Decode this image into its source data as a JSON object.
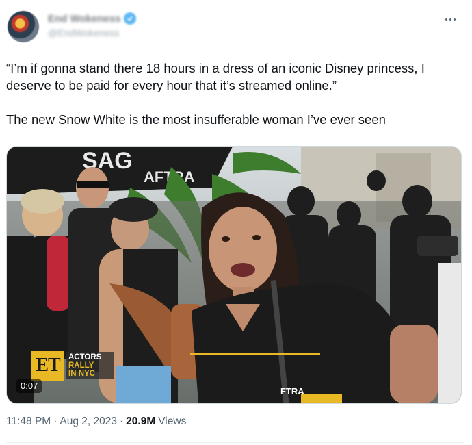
{
  "author": {
    "display_name": "End Wokeness",
    "handle": "@EndWokeness",
    "verified_color": "#1d9bf0"
  },
  "menu": {
    "more_icon": "more-horizontal-icon"
  },
  "tweet": {
    "line1": "“I’m if gonna stand there 18 hours in a dress of an iconic Disney princess, I deserve to be paid for every hour that it’s streamed online.”",
    "line2": "The new Snow White is the most insufferable woman I’ve ever seen"
  },
  "media": {
    "badge_logo": "ET",
    "badge_line1": "ACTORS",
    "badge_line2": "RALLY",
    "badge_line3": "IN NYC",
    "duration": "0:07",
    "banner_text": "SAG",
    "banner_text2": "AFTRA",
    "shirt_text": "FTRA",
    "accent_color": "#e8b924"
  },
  "meta": {
    "time": "11:48 PM",
    "separator": "·",
    "date": "Aug 2, 2023",
    "views_count": "20.9M",
    "views_label": "Views"
  }
}
